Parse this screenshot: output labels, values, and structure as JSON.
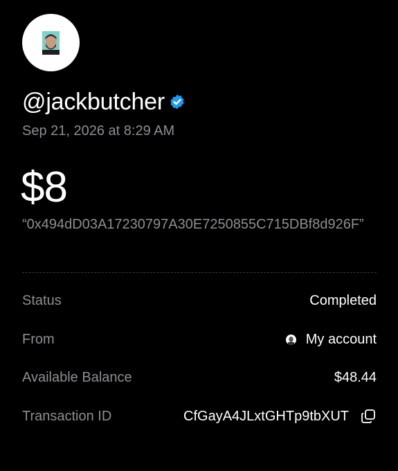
{
  "profile": {
    "avatar_icon": "user-portrait-icon",
    "handle": "@jackbutcher",
    "verified_icon": "verified-badge-icon",
    "verified_color": "#1d9bf0"
  },
  "transaction": {
    "timestamp": "Sep 21, 2026 at 8:29 AM",
    "amount": "$8",
    "memo": "“0x494dD03A17230797A30E7250855C715DBf8d926F”"
  },
  "details": {
    "status": {
      "label": "Status",
      "value": "Completed"
    },
    "from": {
      "label": "From",
      "value": "My account",
      "icon": "account-avatar-icon"
    },
    "balance": {
      "label": "Available Balance",
      "value": "$48.44"
    },
    "transaction_id": {
      "label": "Transaction ID",
      "value": "CfGayA4JLxtGHTp9tbXUT",
      "icon": "copy-icon"
    }
  },
  "colors": {
    "background": "#000000",
    "primary_text": "#ffffff",
    "secondary_text": "#8e8e93",
    "divider": "#3a3a3c"
  }
}
